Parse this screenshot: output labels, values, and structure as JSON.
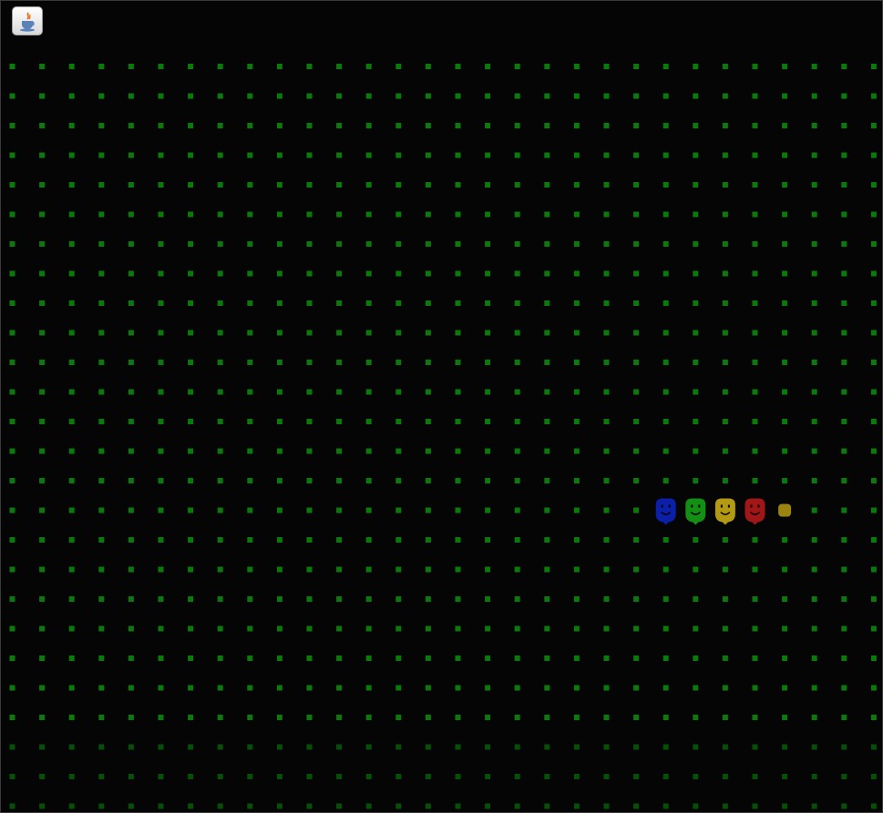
{
  "window": {
    "icon": "java-cup-icon"
  },
  "colors": {
    "background": "#050505",
    "pellet": "#0a7a0a",
    "pellet_dim": "#064f06",
    "player_blue": "#0b1fa8",
    "player_green": "#138f13",
    "player_yellow": "#b39a12",
    "player_red": "#a11616",
    "food": "#9b8410"
  },
  "board": {
    "rows": 26,
    "cols": 30,
    "snake_row": 15,
    "snake_segments": [
      {
        "col": 22,
        "kind": "face",
        "color_key": "player_blue",
        "icon": "blue-face-icon"
      },
      {
        "col": 23,
        "kind": "face",
        "color_key": "player_green",
        "icon": "green-face-icon"
      },
      {
        "col": 24,
        "kind": "face",
        "color_key": "player_yellow",
        "icon": "yellow-face-icon"
      },
      {
        "col": 25,
        "kind": "face",
        "color_key": "player_red",
        "icon": "red-face-icon"
      },
      {
        "col": 26,
        "kind": "food",
        "color_key": "food",
        "icon": "food-pellet-icon"
      }
    ]
  }
}
